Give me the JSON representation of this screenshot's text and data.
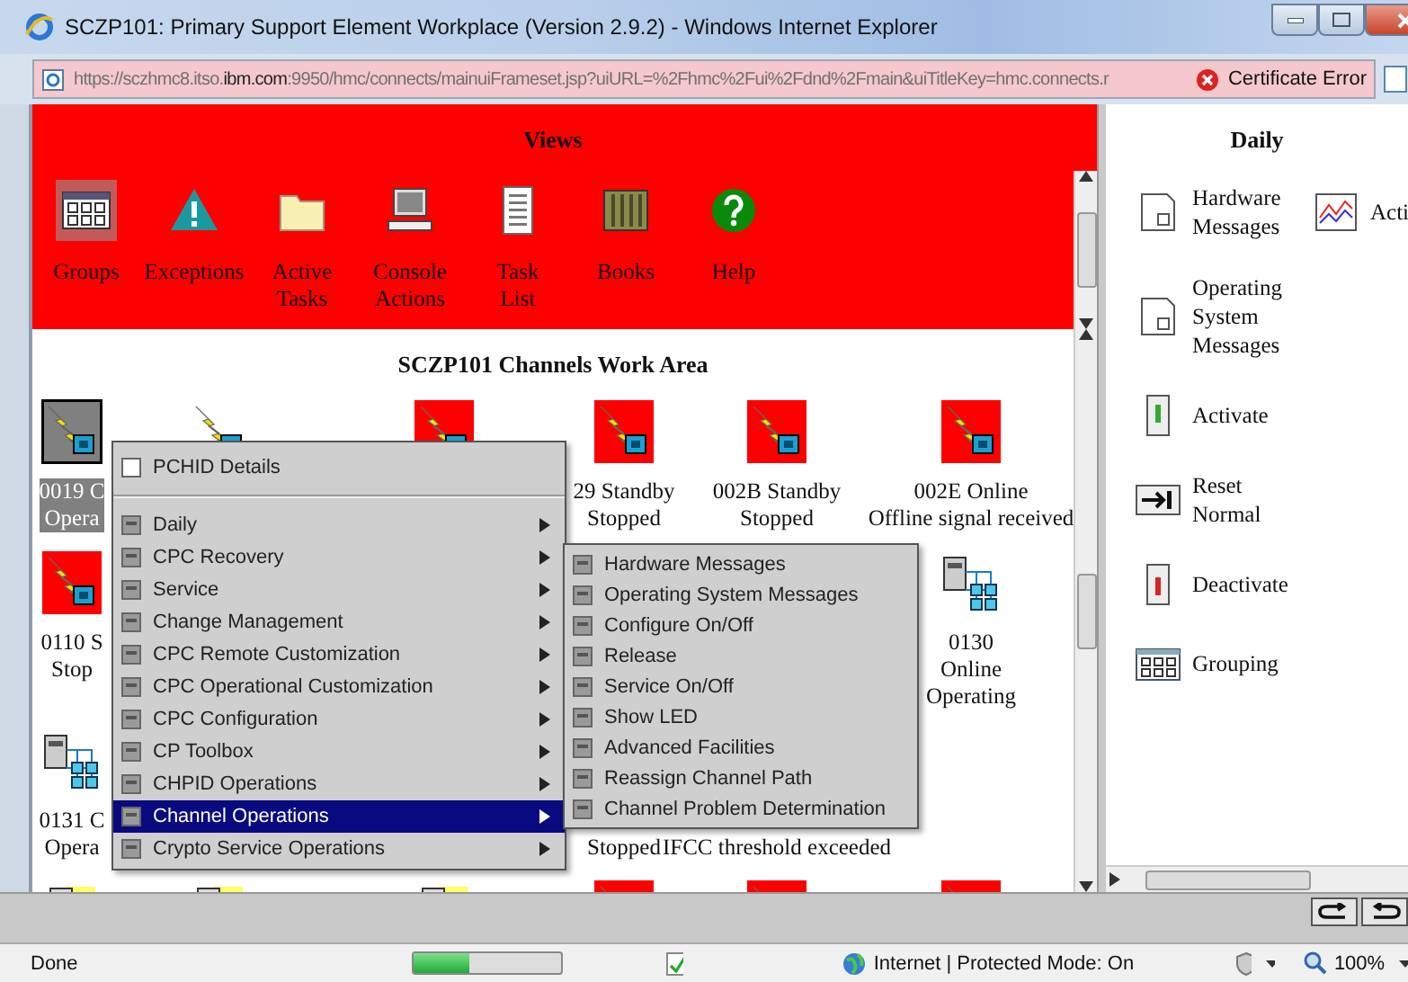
{
  "window": {
    "title": "SCZP101: Primary Support Element Workplace (Version 2.9.2) - Windows Internet Explorer"
  },
  "address_bar": {
    "url": "https://sczhmc8.itso.**ibm.com**:9950/hmc/connects/mainuiFrameset.jsp?uiURL=%2Fhmc%2Fui%2Fdnd%2Fmain&uiTitleKey=hmc.connects.r",
    "certificate_error": "Certificate Error"
  },
  "views": {
    "title": "Views",
    "items": [
      {
        "label": "Groups",
        "kind": "groups",
        "selected": true
      },
      {
        "label": "Exceptions",
        "kind": "exceptions",
        "selected": false
      },
      {
        "label": "Active Tasks",
        "kind": "folder",
        "selected": false
      },
      {
        "label": "Console Actions",
        "kind": "console",
        "selected": false
      },
      {
        "label": "Task List",
        "kind": "list",
        "selected": false
      },
      {
        "label": "Books",
        "kind": "books",
        "selected": false
      },
      {
        "label": "Help",
        "kind": "help",
        "selected": false
      }
    ]
  },
  "work_area": {
    "title": "SCZP101 Channels Work Area",
    "rows": [
      [
        {
          "kind": "channel",
          "color": "#808080",
          "selected": true,
          "lines": [
            "0019 C",
            "Opera"
          ]
        },
        {
          "kind": "channel",
          "selected": false
        },
        {
          "kind": "channel",
          "color": "#ff0000",
          "selected": false
        },
        {
          "kind": "channel",
          "color": "#ff0000",
          "selected": false,
          "lines": [
            "29 Standby",
            "Stopped"
          ]
        },
        {
          "kind": "channel",
          "color": "#ff0000",
          "selected": false,
          "lines": [
            "002B Standby",
            "Stopped"
          ]
        },
        {
          "kind": "channel",
          "color": "#ff0000",
          "selected": false,
          "lines": [
            "002E Online",
            "Offline signal received"
          ]
        }
      ],
      [
        {
          "kind": "channel",
          "color": "#ff0000",
          "selected": false,
          "lines": [
            "0110 S",
            "Stop"
          ]
        },
        {
          "kind": "blank"
        },
        {
          "kind": "blank"
        },
        {
          "kind": "blank"
        },
        {
          "kind": "blank"
        },
        {
          "kind": "network",
          "lines": [
            "0130",
            "Online",
            "Operating"
          ]
        }
      ],
      [
        {
          "kind": "network",
          "lines": [
            "0131 C",
            "Opera"
          ]
        },
        {
          "kind": "blank"
        },
        {
          "kind": "blank"
        },
        {
          "kind": "blank",
          "lines": [
            "Stopped"
          ]
        },
        {
          "kind": "blank",
          "lines": [
            "IFCC threshold exceeded"
          ]
        },
        {
          "kind": "blank"
        }
      ],
      [
        {
          "kind": "device"
        },
        {
          "kind": "device"
        },
        {
          "kind": "device"
        },
        {
          "kind": "channel",
          "color": "#ff0000",
          "selected": false
        },
        {
          "kind": "channel",
          "color": "#ff0000",
          "selected": false
        },
        {
          "kind": "channel",
          "color": "#ff0000",
          "selected": false
        }
      ]
    ]
  },
  "context_menu": {
    "items": [
      {
        "label": "PCHID Details",
        "submenu": false,
        "divider_below": true,
        "selected": false
      },
      {
        "label": "Daily",
        "submenu": true,
        "divider_below": false,
        "selected": false
      },
      {
        "label": "CPC Recovery",
        "submenu": true,
        "divider_below": false,
        "selected": false
      },
      {
        "label": "Service",
        "submenu": true,
        "divider_below": false,
        "selected": false
      },
      {
        "label": "Change Management",
        "submenu": true,
        "divider_below": false,
        "selected": false
      },
      {
        "label": "CPC Remote Customization",
        "submenu": true,
        "divider_below": false,
        "selected": false
      },
      {
        "label": "CPC Operational Customization",
        "submenu": true,
        "divider_below": false,
        "selected": false
      },
      {
        "label": "CPC Configuration",
        "submenu": true,
        "divider_below": false,
        "selected": false
      },
      {
        "label": "CP Toolbox",
        "submenu": true,
        "divider_below": false,
        "selected": false
      },
      {
        "label": "CHPID Operations",
        "submenu": true,
        "divider_below": false,
        "selected": false
      },
      {
        "label": "Channel Operations",
        "submenu": true,
        "divider_below": false,
        "selected": true
      },
      {
        "label": "Crypto Service Operations",
        "submenu": true,
        "divider_below": false,
        "selected": false
      }
    ]
  },
  "submenu": {
    "items": [
      {
        "label": "Hardware Messages"
      },
      {
        "label": "Operating System Messages"
      },
      {
        "label": "Configure On/Off"
      },
      {
        "label": "Release"
      },
      {
        "label": "Service On/Off"
      },
      {
        "label": "Show LED"
      },
      {
        "label": "Advanced Facilities"
      },
      {
        "label": "Reassign Channel Path"
      },
      {
        "label": "Channel Problem Determination"
      }
    ]
  },
  "tasks": {
    "title": "Daily",
    "items": [
      {
        "label": "Hardware Messages",
        "kind": "message"
      },
      {
        "label": "Operating System Messages",
        "kind": "message"
      },
      {
        "label": "Activate",
        "kind": "activate"
      },
      {
        "label": "Reset Normal",
        "kind": "reset"
      },
      {
        "label": "Deactivate",
        "kind": "deactivate"
      },
      {
        "label": "Grouping",
        "kind": "grouping"
      },
      {
        "label": "Acti",
        "kind": "chart"
      }
    ]
  },
  "status_bar": {
    "text": "Done",
    "progress": {
      "level": 0.38
    },
    "zone": "Internet | Protected Mode: On",
    "zoom": "100%"
  }
}
